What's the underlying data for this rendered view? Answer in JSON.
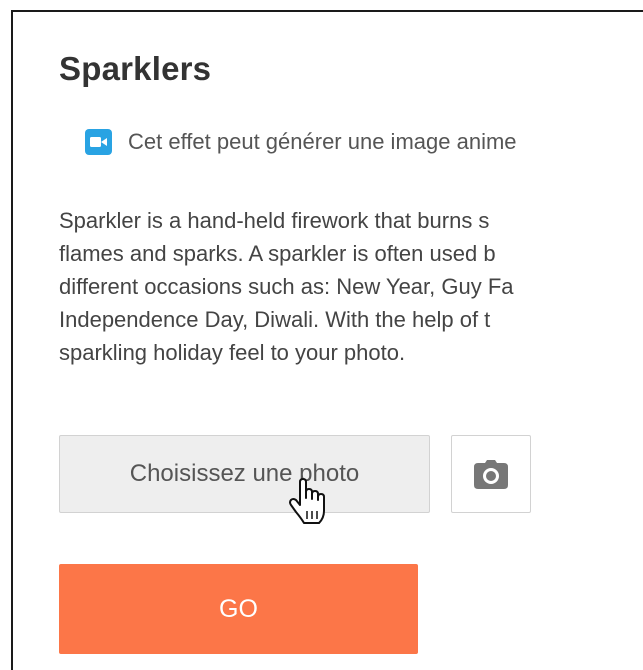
{
  "effect": {
    "title": "Sparklers",
    "notice_text": "Cet effet peut générer une image anime",
    "description_lines": [
      "Sparkler is a hand-held firework that burns s",
      "flames and sparks. A sparkler is often used b",
      "different occasions such as: New Year, Guy Fa",
      "Independence Day, Diwali. With the help of t",
      "sparkling holiday feel to your photo."
    ]
  },
  "upload": {
    "choose_label": "Choisissez une photo"
  },
  "actions": {
    "go_label": "GO"
  },
  "icons": {
    "notice": "video-camera-icon",
    "camera": "camera-icon",
    "cursor": "hand-pointer-icon"
  },
  "colors": {
    "accent": "#fc7648",
    "notice_icon": "#29a3e3",
    "button_bg": "#eeeeee",
    "title": "#333333"
  }
}
